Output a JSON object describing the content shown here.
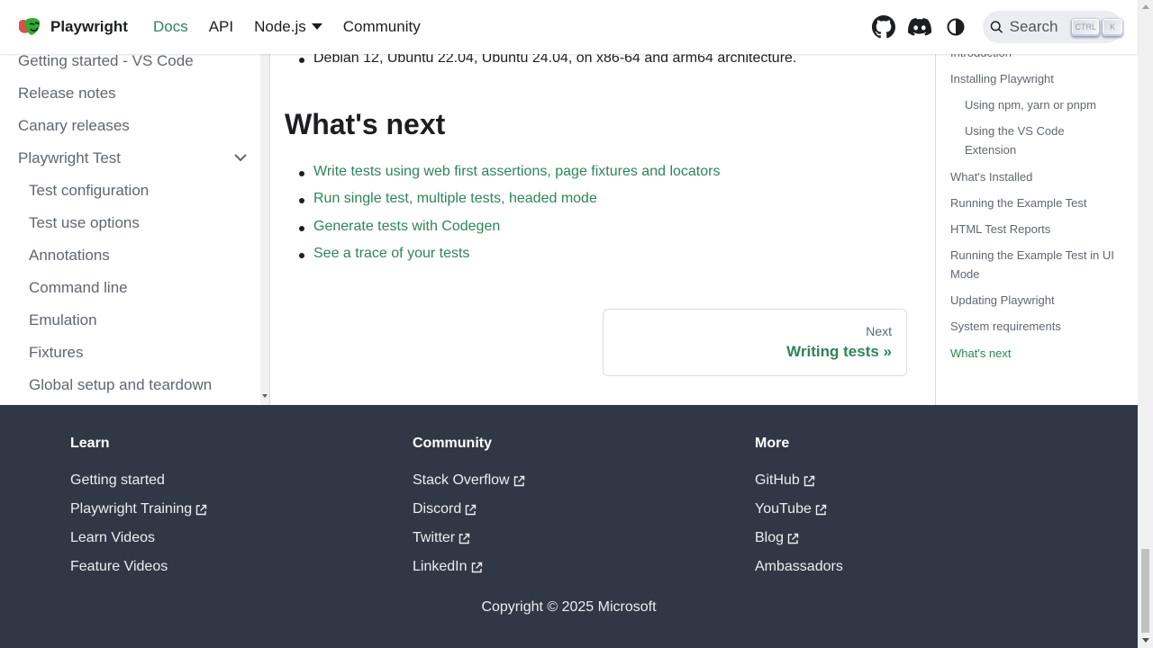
{
  "navbar": {
    "brand": "Playwright",
    "links": [
      "Docs",
      "API",
      "Node.js",
      "Community"
    ],
    "search_label": "Search",
    "kbd_ctrl": "CTRL",
    "kbd_k": "K"
  },
  "sidebar": {
    "items": [
      "Getting started - VS Code",
      "Release notes",
      "Canary releases",
      "Playwright Test",
      "Test configuration",
      "Test use options",
      "Annotations",
      "Command line",
      "Emulation",
      "Fixtures",
      "Global setup and teardown"
    ]
  },
  "main": {
    "top_bullet": "Debian 12, Ubuntu 22.04, Ubuntu 24.04, on x86-64 and arm64 architecture.",
    "heading": "What's next",
    "next_links": [
      "Write tests using web first assertions, page fixtures and locators",
      "Run single test, multiple tests, headed mode",
      "Generate tests with Codegen",
      "See a trace of your tests"
    ],
    "pager": {
      "sublabel": "Next",
      "label": "Writing tests »"
    }
  },
  "toc": {
    "items": [
      "Introduction",
      "Installing Playwright",
      "Using npm, yarn or pnpm",
      "Using the VS Code Extension",
      "What's Installed",
      "Running the Example Test",
      "HTML Test Reports",
      "Running the Example Test in UI Mode",
      "Updating Playwright",
      "System requirements",
      "What's next"
    ]
  },
  "footer": {
    "learn": {
      "title": "Learn",
      "links": [
        "Getting started",
        "Playwright Training",
        "Learn Videos",
        "Feature Videos"
      ]
    },
    "community": {
      "title": "Community",
      "links": [
        "Stack Overflow",
        "Discord",
        "Twitter",
        "LinkedIn"
      ]
    },
    "more": {
      "title": "More",
      "links": [
        "GitHub",
        "YouTube",
        "Blog",
        "Ambassadors"
      ]
    },
    "copyright": "Copyright © 2025 Microsoft"
  },
  "colors": {
    "accent": "#2e8555",
    "footer_bg": "#303846",
    "text": "#1c1e21",
    "muted": "#606770"
  },
  "icons": [
    "playwright-logo",
    "github-icon",
    "discord-icon",
    "theme-toggle-icon",
    "search-icon",
    "chevron-down-icon",
    "external-link-icon"
  ]
}
